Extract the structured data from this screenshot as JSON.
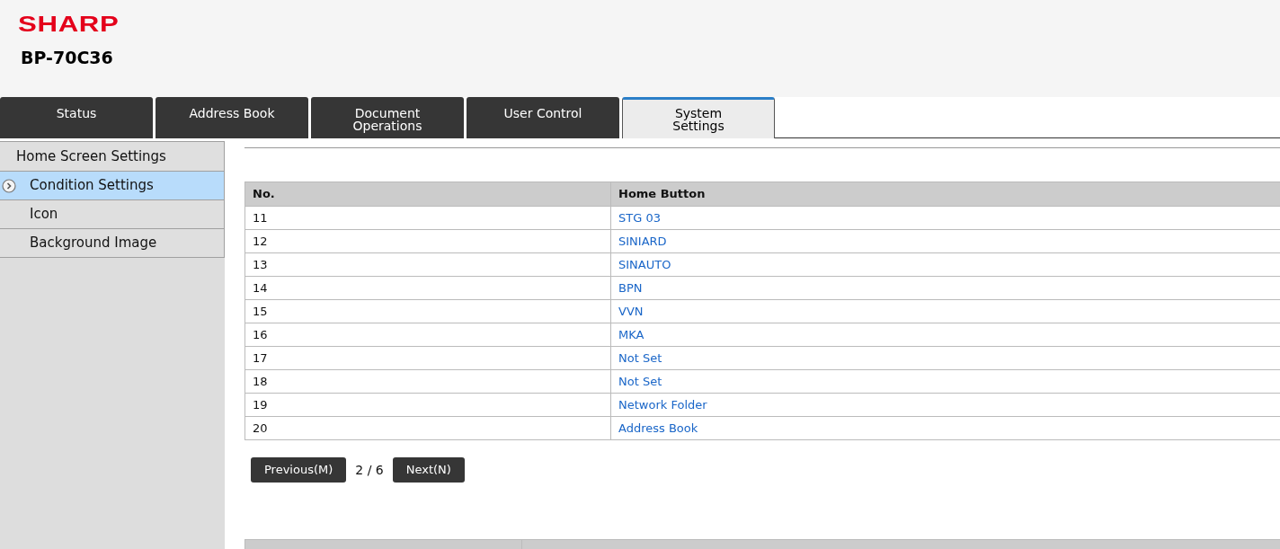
{
  "header": {
    "logo": "SHARP",
    "model": "BP-70C36"
  },
  "tabs": [
    {
      "lines": [
        "Status"
      ],
      "selected": false
    },
    {
      "lines": [
        "Address Book"
      ],
      "selected": false
    },
    {
      "lines": [
        "Document",
        "Operations"
      ],
      "selected": false
    },
    {
      "lines": [
        "User Control"
      ],
      "selected": false
    },
    {
      "lines": [
        "System",
        "Settings"
      ],
      "selected": true
    }
  ],
  "sidebar": {
    "title": "Home Screen Settings",
    "items": [
      {
        "label": "Condition Settings",
        "selected": true
      },
      {
        "label": "Icon",
        "selected": false
      },
      {
        "label": "Background Image",
        "selected": false
      }
    ]
  },
  "table": {
    "columns": [
      "No.",
      "Home Button"
    ],
    "rows": [
      [
        "11",
        "STG 03"
      ],
      [
        "12",
        "SINIARD"
      ],
      [
        "13",
        "SINAUTO"
      ],
      [
        "14",
        "BPN"
      ],
      [
        "15",
        "VVN"
      ],
      [
        "16",
        "MKA"
      ],
      [
        "17",
        "Not Set"
      ],
      [
        "18",
        "Not Set"
      ],
      [
        "19",
        "Network Folder"
      ],
      [
        "20",
        "Address Book"
      ]
    ]
  },
  "pagination": {
    "previous": "Previous(M)",
    "page": "2 / 6",
    "next": "Next(N)"
  }
}
